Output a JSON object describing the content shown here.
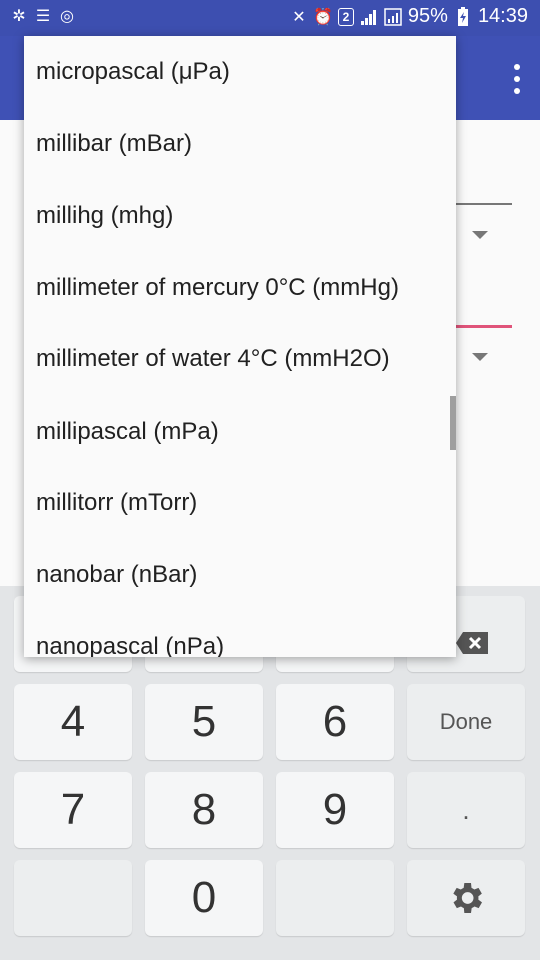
{
  "status_bar": {
    "battery": "95%",
    "time": "14:39",
    "sim_badge": "2"
  },
  "dropdown": {
    "options": [
      "micropascal (μPa)",
      "millibar (mBar)",
      "millihg (mhg)",
      "millimeter of mercury 0°C (mmHg)",
      "millimeter of water 4°C (mmH2O)",
      "millipascal (mPa)",
      "millitorr (mTorr)",
      "nanobar (nBar)",
      "nanopascal (nPa)"
    ]
  },
  "keyboard": {
    "keys": {
      "k4": "4",
      "k5": "5",
      "k6": "6",
      "done": "Done",
      "k7": "7",
      "k8": "8",
      "k9": "9",
      "dot": ".",
      "k0": "0"
    }
  }
}
